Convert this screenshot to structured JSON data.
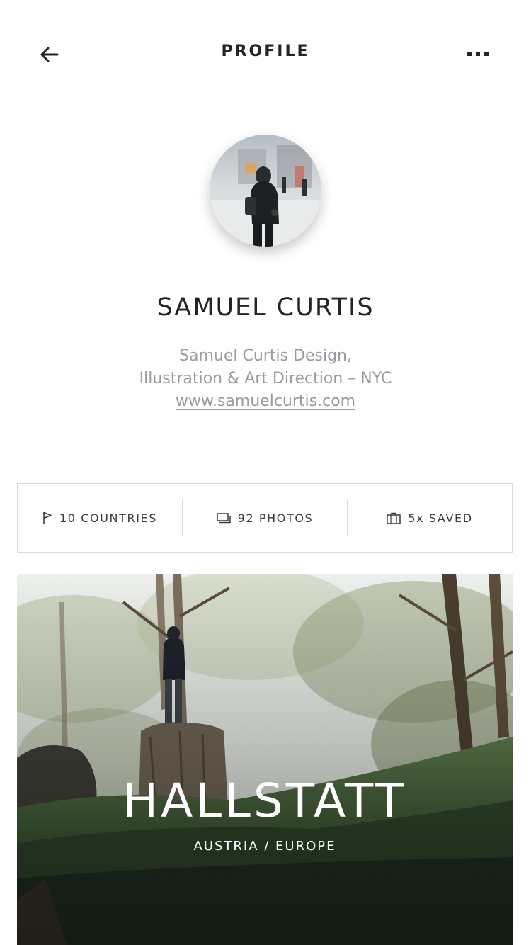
{
  "header": {
    "title": "PROFILE",
    "back_icon": "arrow-left-icon",
    "more_icon": "more-horizontal-icon"
  },
  "profile": {
    "name": "SAMUEL CURTIS",
    "bio_line1": "Samuel Curtis Design,",
    "bio_line2": "Illustration & Art Direction – NYC",
    "website": "www.samuelcurtis.com"
  },
  "stats": [
    {
      "icon": "flag-icon",
      "label": "10 COUNTRIES"
    },
    {
      "icon": "photos-icon",
      "label": "92 PHOTOS"
    },
    {
      "icon": "briefcase-icon",
      "label": "5x SAVED"
    }
  ],
  "card": {
    "title": "HALLSTATT",
    "subtitle": "AUSTRIA / EUROPE"
  },
  "colors": {
    "text_dark": "#23232b",
    "text_muted": "#9a9aa2",
    "border": "#d9d9de"
  }
}
